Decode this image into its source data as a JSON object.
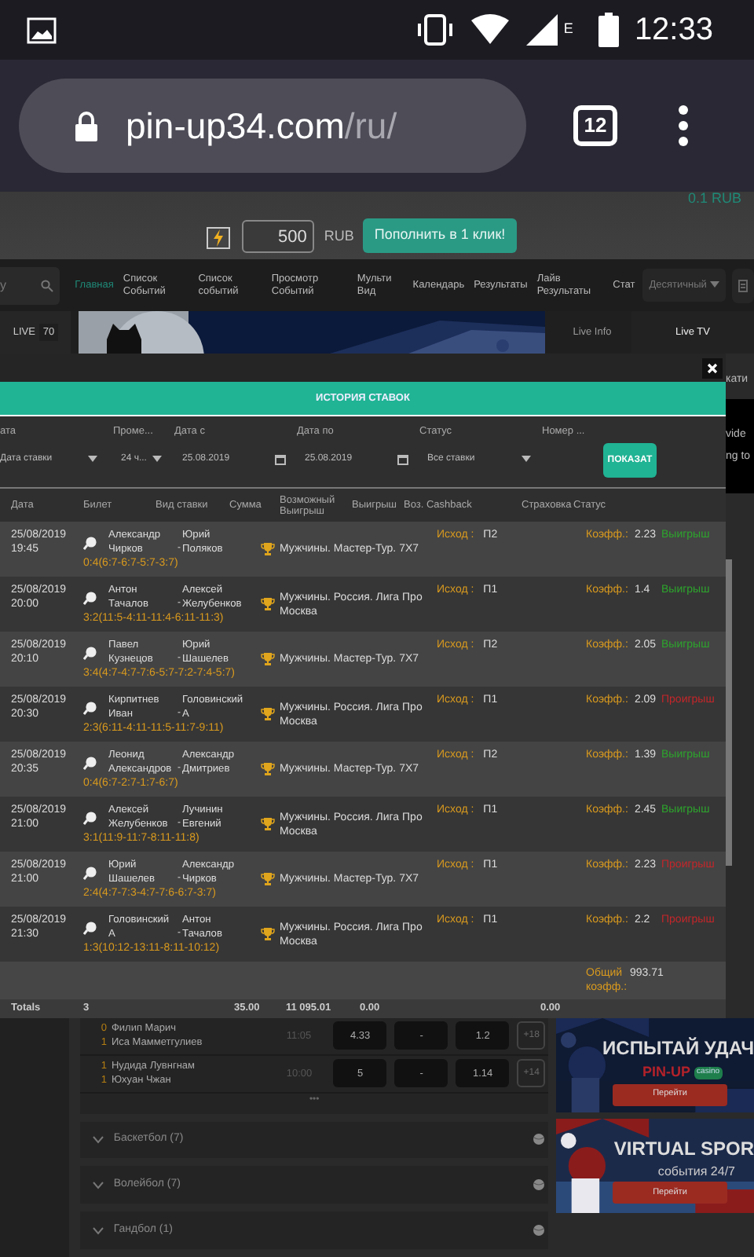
{
  "status_bar": {
    "time": "12:33",
    "network": "E"
  },
  "browser": {
    "url_host": "pin-up34.com",
    "url_path": "/ru/",
    "tab_count": "12"
  },
  "header": {
    "balance": "0.1 RUB",
    "deposit_amount": "500",
    "currency": "RUB",
    "deposit_button": "Пополнить в 1 клик!"
  },
  "nav": {
    "search_placeholder": "у",
    "items": [
      {
        "label": "Главная",
        "selected": true
      },
      {
        "label": "Список Событий",
        "selected": false
      },
      {
        "label": "Список событий",
        "selected": false
      },
      {
        "label": "Просмотр Событий",
        "selected": false
      },
      {
        "label": "Мульти Вид",
        "selected": false
      },
      {
        "label": "Календарь",
        "selected": false
      },
      {
        "label": "Результаты",
        "selected": false
      },
      {
        "label": "Лайв Результаты",
        "selected": false
      },
      {
        "label": "Стат",
        "selected": false
      }
    ],
    "odds_format": "Десятичный"
  },
  "live_bar": {
    "label": "LIVE",
    "count": "70",
    "tabs": [
      {
        "label": "Live Info",
        "selected": false
      },
      {
        "label": "Live TV",
        "selected": true
      }
    ]
  },
  "behind_modal": [
    "кати",
    "vide",
    "ng to"
  ],
  "modal": {
    "title": "ИСТОРИЯ СТАВОК",
    "filters": [
      {
        "label": "ата",
        "value": "Дата ставки",
        "kind": "select"
      },
      {
        "label": "Проме...",
        "value": "24 ч...",
        "kind": "select"
      },
      {
        "label": "Дата с",
        "value": "25.08.2019",
        "kind": "date"
      },
      {
        "label": "Дата по",
        "value": "25.08.2019",
        "kind": "date"
      },
      {
        "label": "Статус",
        "value": "Все ставки",
        "kind": "select"
      },
      {
        "label": "Номер ...",
        "kind": "text"
      }
    ],
    "show_button": "ПОКАЗАТ",
    "columns": [
      "Дата",
      "Билет",
      "Вид ставки",
      "Сумма",
      "Возможный Выигрыш",
      "Выигрыш",
      "Воз. Cashback",
      "Страховка",
      "Статус"
    ],
    "rows": [
      {
        "date": "25/08/2019",
        "time": "19:45",
        "player1": "Александр Чирков",
        "separator": "-",
        "player2": "Юрий Поляков",
        "score": "0:4(6:7-6:7-5:7-3:7)",
        "tournament": "Мужчины. Мастер-Тур. 7Х7",
        "outcome_label": "Исход :",
        "outcome": "П2",
        "coef_label": "Коэфф.:",
        "coef": "2.23",
        "status": "Выигрыш",
        "won": true
      },
      {
        "date": "25/08/2019",
        "time": "20:00",
        "player1": "Антон Тачалов",
        "separator": "-",
        "player2": "Алексей Желубенков",
        "score": "3:2(11:5-4:11-11:4-6:11-11:3)",
        "tournament": "Мужчины. Россия. Лига Про Москва",
        "outcome_label": "Исход :",
        "outcome": "П1",
        "coef_label": "Коэфф.:",
        "coef": "1.4",
        "status": "Выигрыш",
        "won": true
      },
      {
        "date": "25/08/2019",
        "time": "20:10",
        "player1": "Павел Кузнецов",
        "separator": "-",
        "player2": "Юрий Шашелев",
        "score": "3:4(4:7-4:7-7:6-5:7-7:2-7:4-5:7)",
        "tournament": "Мужчины. Мастер-Тур. 7Х7",
        "outcome_label": "Исход :",
        "outcome": "П2",
        "coef_label": "Коэфф.:",
        "coef": "2.05",
        "status": "Выигрыш",
        "won": true
      },
      {
        "date": "25/08/2019",
        "time": "20:30",
        "player1": "Кирпитнев Иван",
        "separator": "-",
        "player2": "Головинский А",
        "score": "2:3(6:11-4:11-11:5-11:7-9:11)",
        "tournament": "Мужчины. Россия. Лига Про Москва",
        "outcome_label": "Исход :",
        "outcome": "П1",
        "coef_label": "Коэфф.:",
        "coef": "2.09",
        "status": "Проигрыш",
        "won": false
      },
      {
        "date": "25/08/2019",
        "time": "20:35",
        "player1": "Леонид Александров",
        "separator": "-",
        "player2": "Александр Дмитриев",
        "score": "0:4(6:7-2:7-1:7-6:7)",
        "tournament": "Мужчины. Мастер-Тур. 7Х7",
        "outcome_label": "Исход :",
        "outcome": "П2",
        "coef_label": "Коэфф.:",
        "coef": "1.39",
        "status": "Выигрыш",
        "won": true
      },
      {
        "date": "25/08/2019",
        "time": "21:00",
        "player1": "Алексей Желубенков",
        "separator": "-",
        "player2": "Лучинин Евгений",
        "score": "3:1(11:9-11:7-8:11-11:8)",
        "tournament": "Мужчины. Россия. Лига Про Москва",
        "outcome_label": "Исход :",
        "outcome": "П1",
        "coef_label": "Коэфф.:",
        "coef": "2.45",
        "status": "Выигрыш",
        "won": true
      },
      {
        "date": "25/08/2019",
        "time": "21:00",
        "player1": "Юрий Шашелев",
        "separator": "-",
        "player2": "Александр Чирков",
        "score": "2:4(4:7-7:3-4:7-7:6-6:7-3:7)",
        "tournament": "Мужчины. Мастер-Тур. 7Х7",
        "outcome_label": "Исход :",
        "outcome": "П1",
        "coef_label": "Коэфф.:",
        "coef": "2.23",
        "status": "Проигрыш",
        "won": false
      },
      {
        "date": "25/08/2019",
        "time": "21:30",
        "player1": "Головинский А",
        "separator": "-",
        "player2": "Антон Тачалов",
        "score": "1:3(10:12-13:11-8:11-10:12)",
        "tournament": "Мужчины. Россия. Лига Про Москва",
        "outcome_label": "Исход :",
        "outcome": "П1",
        "coef_label": "Коэфф.:",
        "coef": "2.2",
        "status": "Проигрыш",
        "won": false
      }
    ],
    "summary": {
      "label": "Общий коэфф.:",
      "value": "993.71"
    },
    "totals": {
      "label": "Totals",
      "count": "3",
      "stake": "35.00",
      "possible_win": "11 095.01",
      "win": "0.00",
      "insurance": "0.00"
    }
  },
  "events": [
    {
      "score1": "0",
      "team1": "Филип Марич",
      "score2": "1",
      "team2": "Иса Мамметгулиев",
      "time": "11:05",
      "odds": [
        "4.33",
        "-",
        "1.2"
      ],
      "more": "+18"
    },
    {
      "score1": "1",
      "team1": "Нудида Лувнгнам",
      "score2": "1",
      "team2": "Юхуан Чжан",
      "time": "10:00",
      "odds": [
        "5",
        "-",
        "1.14"
      ],
      "more": "+14"
    }
  ],
  "more_dots": "•••",
  "sports": [
    "Баскетбол (7)",
    "Волейбол (7)",
    "Гандбол (1)"
  ],
  "ads": [
    {
      "title": "ИСПЫТАЙ УДАЧ",
      "brand": "PIN-UP",
      "brand_tag": "casino",
      "button": "Перейти"
    },
    {
      "title": "VIRTUAL SPOR",
      "subtitle": "события 24/7",
      "button": "Перейти"
    }
  ]
}
